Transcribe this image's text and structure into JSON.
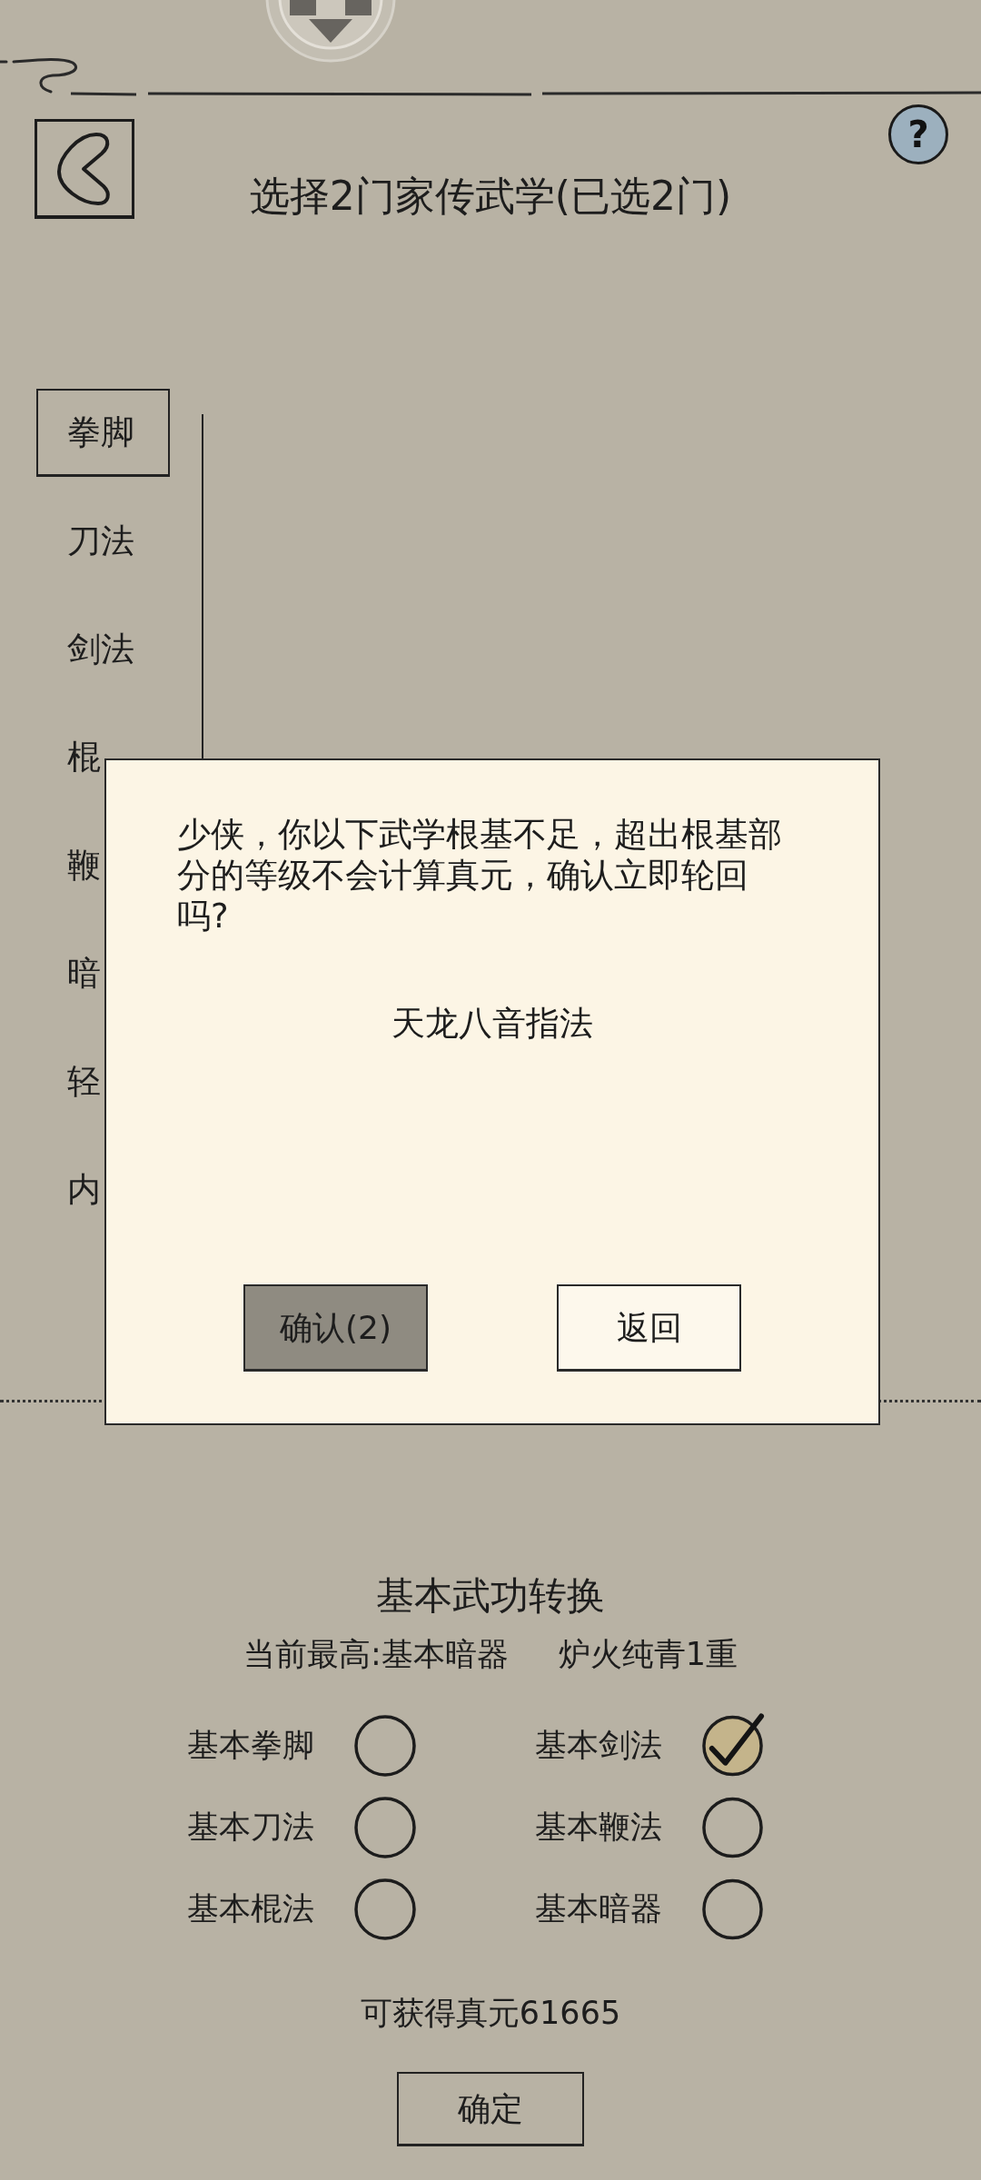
{
  "header": {
    "title": "选择2门家传武学(已选2门)",
    "help_button": "?"
  },
  "categories": [
    {
      "label": "拳脚",
      "selected": true
    },
    {
      "label": "刀法",
      "selected": false
    },
    {
      "label": "剑法",
      "selected": false
    },
    {
      "label": "棍",
      "selected": false
    },
    {
      "label": "鞭",
      "selected": false
    },
    {
      "label": "暗",
      "selected": false
    },
    {
      "label": "轻",
      "selected": false
    },
    {
      "label": "内",
      "selected": false
    }
  ],
  "dialog": {
    "message": "少侠，你以下武学根基不足，超出根基部分的等级不会计算真元，确认立即轮回吗?",
    "skill": "天龙八音指法",
    "buttons": [
      {
        "label": "确认(2)",
        "kind": "confirm"
      },
      {
        "label": "返回",
        "kind": "back"
      }
    ]
  },
  "conversion": {
    "title": "基本武功转换",
    "current_highest": "当前最高:基本暗器",
    "rank": "炉火纯青1重",
    "options": [
      {
        "label": "基本拳脚",
        "checked": false
      },
      {
        "label": "基本剑法",
        "checked": true
      },
      {
        "label": "基本刀法",
        "checked": false
      },
      {
        "label": "基本鞭法",
        "checked": false
      },
      {
        "label": "基本棍法",
        "checked": false
      },
      {
        "label": "基本暗器",
        "checked": false
      }
    ],
    "reward": "可获得真元61665",
    "confirm_button": "确定"
  }
}
